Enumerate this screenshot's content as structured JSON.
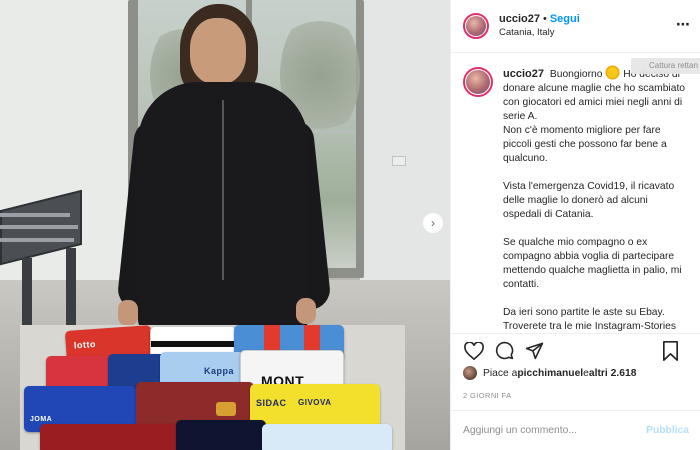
{
  "header": {
    "username": "uccio27",
    "separator": "•",
    "follow_label": "Segui",
    "location": "Catania, Italy",
    "more_icon": "⋯"
  },
  "caption": {
    "username": "uccio27",
    "intro_before_emoji": "Buongiorno",
    "intro_after_emoji": "Ho deciso di donare alcune maglie che ho scambiato con giocatori ed amici miei negli anni di serie A.",
    "line2": "Non c'è momento migliore per fare piccoli gesti che possono far bene a qualcuno.",
    "para2": "Vista l'emergenza Covid19, il ricavato delle maglie lo donerò ad alcuni ospedali di Catania.",
    "para3": "Se qualche mio compagno o ex compagno abbia voglia di partecipare mettendo qualche maglietta in palio, mi contatti.",
    "para4": "Da ieri sono partite le aste su Ebay. Troverete tra le mie Instagram-Stories",
    "tooltip": "Cattura rettan"
  },
  "actions": {
    "like_icon": "heart-icon",
    "comment_icon": "comment-icon",
    "share_icon": "share-icon",
    "save_icon": "bookmark-icon"
  },
  "likes": {
    "prefix": "Piace a ",
    "user": "picchimanuel",
    "middle": " e ",
    "others": "altri 2.618"
  },
  "date": "2 GIORNI FA",
  "comment": {
    "placeholder": "Aggiungi un commento...",
    "publish_label": "Pubblica"
  },
  "photo": {
    "next_icon": "›",
    "jerseys": {
      "lotto": "lotto",
      "kappa": "Kappa",
      "mont": "MONT",
      "sidac": "SIDAC",
      "givova": "GIVOVA",
      "joma": "JOMA"
    }
  },
  "colors": {
    "accent": "#0095f6",
    "text": "#262626",
    "muted": "#8e8e8e",
    "publish_disabled": "#b2dffc",
    "story_ring": "#e1306c"
  }
}
